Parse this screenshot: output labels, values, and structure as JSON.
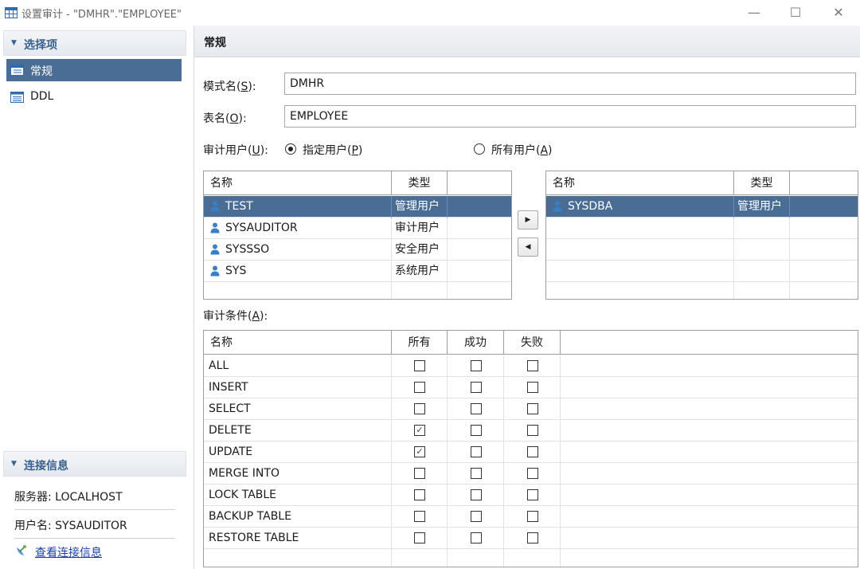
{
  "window": {
    "title": "设置审计 - \"DMHR\".\"EMPLOYEE\"",
    "minimize": "—",
    "maximize": "☐",
    "close": "✕"
  },
  "sidebar": {
    "options_header": "选择项",
    "items": [
      {
        "label": "常规",
        "icon": "grid-table-icon",
        "selected": true
      },
      {
        "label": "DDL",
        "icon": "list-document-icon",
        "selected": false
      }
    ],
    "connection_header": "连接信息",
    "server_line": "服务器: LOCALHOST",
    "user_line": "用户名: SYSAUDITOR",
    "view_connection_link": "查看连接信息"
  },
  "main": {
    "section_title": "常规",
    "schema_label": "模式名(",
    "schema_key": "S",
    "schema_label_end": "):",
    "schema_value": "DMHR",
    "table_label": "表名(",
    "table_key": "O",
    "table_label_end": "):",
    "table_value": "EMPLOYEE",
    "audit_user_label": "审计用户(",
    "audit_user_key": "U",
    "audit_user_label_end": "):",
    "radio_specified": "指定用户(",
    "radio_specified_key": "P",
    "radio_specified_end": ")",
    "radio_all": "所有用户(",
    "radio_all_key": "A",
    "radio_all_end": ")",
    "selected_radio": "specified",
    "move_right": "▶",
    "move_left": "◀",
    "available_users": {
      "headers": [
        "名称",
        "类型"
      ],
      "rows": [
        {
          "name": "TEST",
          "type": "管理用户",
          "selected": true
        },
        {
          "name": "SYSAUDITOR",
          "type": "审计用户",
          "selected": false
        },
        {
          "name": "SYSSSO",
          "type": "安全用户",
          "selected": false
        },
        {
          "name": "SYS",
          "type": "系统用户",
          "selected": false
        }
      ]
    },
    "selected_users": {
      "headers": [
        "名称",
        "类型"
      ],
      "rows": [
        {
          "name": "SYSDBA",
          "type": "管理用户",
          "selected": true
        }
      ]
    },
    "conditions_label": "审计条件(",
    "conditions_key": "A",
    "conditions_label_end": "):",
    "conditions": {
      "headers": [
        "名称",
        "所有",
        "成功",
        "失败"
      ],
      "rows": [
        {
          "name": "ALL",
          "all": false,
          "success": false,
          "fail": false
        },
        {
          "name": "INSERT",
          "all": false,
          "success": false,
          "fail": false
        },
        {
          "name": "SELECT",
          "all": false,
          "success": false,
          "fail": false
        },
        {
          "name": "DELETE",
          "all": true,
          "success": false,
          "fail": false
        },
        {
          "name": "UPDATE",
          "all": true,
          "success": false,
          "fail": false
        },
        {
          "name": "MERGE INTO",
          "all": false,
          "success": false,
          "fail": false
        },
        {
          "name": "LOCK TABLE",
          "all": false,
          "success": false,
          "fail": false
        },
        {
          "name": "BACKUP TABLE",
          "all": false,
          "success": false,
          "fail": false
        },
        {
          "name": "RESTORE TABLE",
          "all": false,
          "success": false,
          "fail": false
        }
      ]
    }
  },
  "colors": {
    "selection": "#4a6d96",
    "header_text": "#38618f",
    "user_icon": "#3a7fc4",
    "link": "#1a3fa8"
  }
}
